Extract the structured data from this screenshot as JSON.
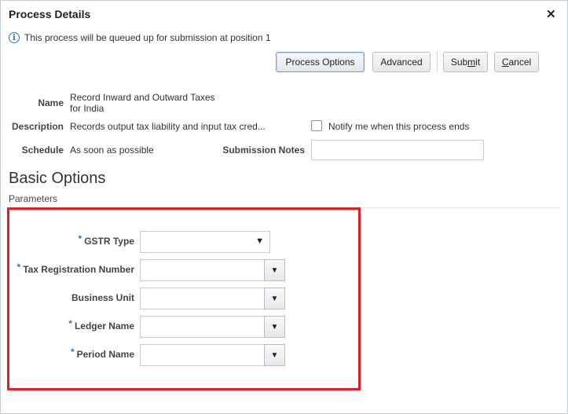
{
  "dialog": {
    "title": "Process Details",
    "close_icon": "✕",
    "info_message": "This process will be queued up for submission at position 1"
  },
  "buttons": {
    "process_options": "Process Options",
    "advanced": "Advanced",
    "submit": "Submit",
    "cancel": "Cancel"
  },
  "details": {
    "name_label": "Name",
    "name_value_line1": "Record Inward and Outward Taxes",
    "name_value_line2": "for India",
    "description_label": "Description",
    "description_value": "Records output tax liability and input tax cred...",
    "notify_label": "Notify me when this process ends",
    "schedule_label": "Schedule",
    "schedule_value": "As soon as possible",
    "submission_notes_label": "Submission Notes",
    "submission_notes_value": ""
  },
  "basic_options": {
    "title": "Basic Options",
    "parameters_label": "Parameters",
    "required_marker": "*",
    "params": [
      {
        "label": "GSTR Type",
        "required": true,
        "value": ""
      },
      {
        "label": "Tax Registration Number",
        "required": true,
        "value": ""
      },
      {
        "label": "Business Unit",
        "required": false,
        "value": ""
      },
      {
        "label": "Ledger Name",
        "required": true,
        "value": ""
      },
      {
        "label": "Period Name",
        "required": true,
        "value": ""
      }
    ]
  },
  "colors": {
    "accent": "#2c73c6",
    "highlight_border": "#e01f26"
  }
}
